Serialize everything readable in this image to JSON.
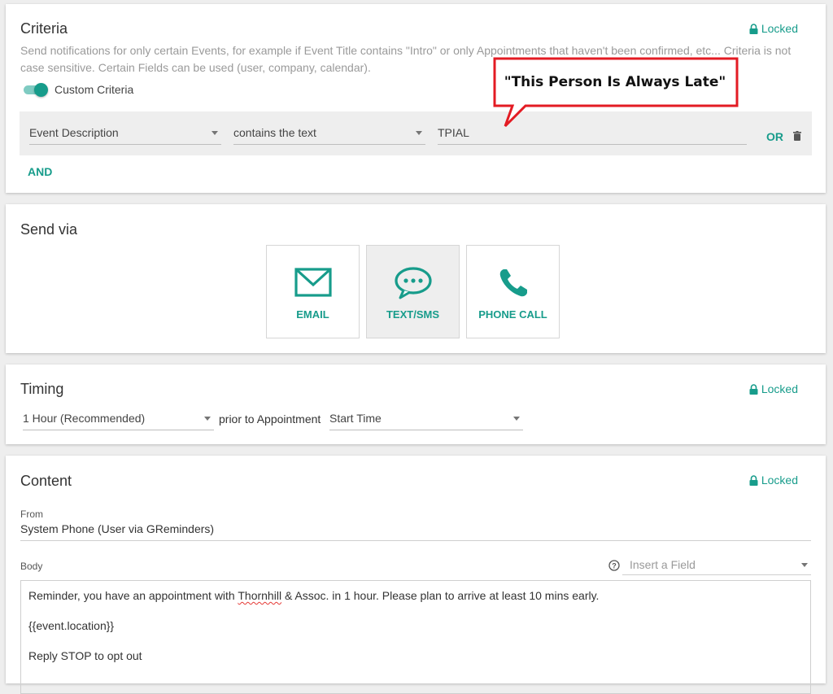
{
  "criteria": {
    "title": "Criteria",
    "locked_label": "Locked",
    "description": "Send notifications for only certain Events, for example if Event Title contains \"Intro\" or only Appointments that haven't been confirmed, etc... Criteria is not case sensitive. Certain Fields can be used (user, company, calendar).",
    "toggle_label": "Custom Criteria",
    "toggle_on": true,
    "rule": {
      "field": "Event Description",
      "operator": "contains the text",
      "value": "TPIAL",
      "or_label": "OR"
    },
    "and_label": "AND"
  },
  "callout": {
    "text": "\"This Person Is Always Late\"",
    "border_color": "#e31b23"
  },
  "send_via": {
    "title": "Send via",
    "options": [
      {
        "label": "EMAIL",
        "icon": "envelope-icon",
        "selected": false
      },
      {
        "label": "TEXT/SMS",
        "icon": "chat-bubble-icon",
        "selected": true
      },
      {
        "label": "PHONE CALL",
        "icon": "phone-icon",
        "selected": false
      }
    ]
  },
  "timing": {
    "title": "Timing",
    "locked_label": "Locked",
    "offset": "1 Hour (Recommended)",
    "prior_text": "prior to Appointment",
    "anchor": "Start Time"
  },
  "content": {
    "title": "Content",
    "locked_label": "Locked",
    "from_label": "From",
    "from_value": "System Phone (User via GReminders)",
    "body_label": "Body",
    "insert_field_placeholder": "Insert a Field",
    "body_line1_pre": "Reminder, you have an appointment with ",
    "body_line1_misspelled": "Thornhill",
    "body_line1_post": " & Assoc. in 1 hour. Please plan to arrive at least 10 mins early.",
    "body_line2": "{{event.location}}",
    "body_line3": "Reply STOP to opt out"
  },
  "colors": {
    "accent": "#179c8b",
    "background": "#eeeeee"
  }
}
